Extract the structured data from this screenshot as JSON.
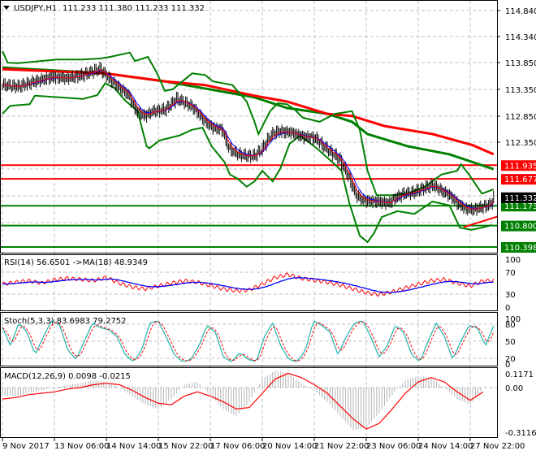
{
  "header": {
    "symbol": "USDJPY,H1",
    "ohlc": "111.233 111.380 111.233 111.332"
  },
  "colors": {
    "bull_bear_bars": "#000000",
    "bollinger": "#008000",
    "ma_slow_green": "#008000",
    "ma_slow_red": "#ff0000",
    "fast_ma_red": "#ff0000",
    "fast_ma_blue": "#0000ff",
    "level_red": "#ff0000",
    "level_green": "#008000",
    "stoch_main": "#20b2aa",
    "stoch_signal": "#ff0000",
    "macd_hist": "#b4b4b4",
    "macd_signal": "#ff0000",
    "rsi": "#ff0000",
    "rsi_ma": "#0000ff",
    "grid": "#c0c0c0"
  },
  "chart_data": [
    {
      "type": "line",
      "title": "USDJPY,H1",
      "ylim": [
        110.398,
        114.84
      ],
      "y_ticks": [
        "114.840",
        "114.340",
        "113.850",
        "113.350",
        "112.850",
        "112.350"
      ],
      "x_ticks": [
        "9 Nov 2017",
        "13 Nov 06:00",
        "14 Nov 14:00",
        "15 Nov 22:00",
        "17 Nov 06:00",
        "20 Nov 14:00",
        "21 Nov 22:00",
        "23 Nov 06:00",
        "24 Nov 14:00",
        "27 Nov 22:00"
      ],
      "grid": true,
      "price_close": [
        [
          0,
          113.44
        ],
        [
          12,
          113.41
        ],
        [
          25,
          113.51
        ],
        [
          38,
          113.59
        ],
        [
          50,
          113.57
        ],
        [
          62,
          113.63
        ],
        [
          75,
          113.74
        ],
        [
          84,
          113.51
        ],
        [
          97,
          113.25
        ],
        [
          103,
          112.95
        ],
        [
          109,
          112.86
        ],
        [
          116,
          112.95
        ],
        [
          125,
          112.98
        ],
        [
          134,
          113.18
        ],
        [
          141,
          113.1
        ],
        [
          147,
          113.01
        ],
        [
          156,
          112.75
        ],
        [
          162,
          112.64
        ],
        [
          169,
          112.6
        ],
        [
          174,
          112.25
        ],
        [
          181,
          112.14
        ],
        [
          188,
          112.11
        ],
        [
          194,
          112.11
        ],
        [
          200,
          112.25
        ],
        [
          206,
          112.49
        ],
        [
          212,
          112.57
        ],
        [
          222,
          112.55
        ],
        [
          231,
          112.47
        ],
        [
          241,
          112.44
        ],
        [
          247,
          112.29
        ],
        [
          253,
          112.17
        ],
        [
          259,
          112.06
        ],
        [
          266,
          111.73
        ],
        [
          272,
          111.37
        ],
        [
          278,
          111.27
        ],
        [
          288,
          111.25
        ],
        [
          297,
          111.22
        ],
        [
          303,
          111.33
        ],
        [
          309,
          111.4
        ],
        [
          316,
          111.42
        ],
        [
          322,
          111.48
        ],
        [
          331,
          111.56
        ],
        [
          338,
          111.45
        ],
        [
          344,
          111.37
        ],
        [
          350,
          111.22
        ],
        [
          356,
          111.12
        ],
        [
          362,
          111.1
        ],
        [
          369,
          111.15
        ],
        [
          375,
          111.19
        ],
        [
          378,
          111.33
        ]
      ],
      "bollinger_upper": [
        [
          0,
          114.08
        ],
        [
          4,
          113.86
        ],
        [
          12,
          113.85
        ],
        [
          42,
          113.92
        ],
        [
          62,
          113.92
        ],
        [
          75,
          113.94
        ],
        [
          83,
          113.97
        ],
        [
          98,
          114.05
        ],
        [
          102,
          113.89
        ],
        [
          112,
          113.97
        ],
        [
          119,
          113.66
        ],
        [
          125,
          113.33
        ],
        [
          131,
          113.36
        ],
        [
          146,
          113.66
        ],
        [
          156,
          113.63
        ],
        [
          162,
          113.51
        ],
        [
          177,
          113.44
        ],
        [
          188,
          113.13
        ],
        [
          194,
          112.75
        ],
        [
          197,
          112.52
        ],
        [
          206,
          112.95
        ],
        [
          212,
          113.1
        ],
        [
          219,
          113.08
        ],
        [
          225,
          112.98
        ],
        [
          231,
          112.83
        ],
        [
          244,
          112.75
        ],
        [
          256,
          112.9
        ],
        [
          269,
          112.95
        ],
        [
          275,
          112.6
        ],
        [
          281,
          111.83
        ],
        [
          288,
          111.37
        ],
        [
          300,
          111.37
        ],
        [
          312,
          111.4
        ],
        [
          325,
          111.53
        ],
        [
          338,
          111.76
        ],
        [
          350,
          111.83
        ],
        [
          353,
          111.95
        ],
        [
          359,
          111.76
        ],
        [
          369,
          111.4
        ],
        [
          378,
          111.48
        ]
      ],
      "bollinger_lower": [
        [
          0,
          112.9
        ],
        [
          6,
          113.05
        ],
        [
          21,
          113.08
        ],
        [
          25,
          113.24
        ],
        [
          62,
          113.18
        ],
        [
          73,
          113.25
        ],
        [
          79,
          113.47
        ],
        [
          86,
          113.39
        ],
        [
          94,
          113.16
        ],
        [
          104,
          112.95
        ],
        [
          111,
          112.29
        ],
        [
          113,
          112.25
        ],
        [
          121,
          112.4
        ],
        [
          136,
          112.49
        ],
        [
          146,
          112.6
        ],
        [
          154,
          112.64
        ],
        [
          161,
          112.29
        ],
        [
          171,
          111.99
        ],
        [
          175,
          111.76
        ],
        [
          181,
          111.68
        ],
        [
          188,
          111.53
        ],
        [
          194,
          111.63
        ],
        [
          200,
          111.83
        ],
        [
          208,
          111.63
        ],
        [
          214,
          111.88
        ],
        [
          221,
          112.34
        ],
        [
          229,
          112.49
        ],
        [
          242,
          112.25
        ],
        [
          254,
          111.99
        ],
        [
          261,
          111.83
        ],
        [
          267,
          111.22
        ],
        [
          275,
          110.61
        ],
        [
          281,
          110.49
        ],
        [
          286,
          110.66
        ],
        [
          292,
          110.96
        ],
        [
          304,
          111.07
        ],
        [
          317,
          111.02
        ],
        [
          331,
          111.25
        ],
        [
          344,
          111.18
        ],
        [
          352,
          110.76
        ],
        [
          361,
          110.72
        ],
        [
          369,
          110.76
        ],
        [
          377,
          110.81
        ]
      ],
      "ma_green": [
        [
          0,
          113.77
        ],
        [
          79,
          113.66
        ],
        [
          125,
          113.51
        ],
        [
          194,
          113.21
        ],
        [
          219,
          113.01
        ],
        [
          250,
          112.9
        ],
        [
          269,
          112.75
        ],
        [
          281,
          112.52
        ],
        [
          312,
          112.29
        ],
        [
          344,
          112.14
        ],
        [
          378,
          111.86
        ]
      ],
      "ma_red": [
        [
          0,
          113.74
        ],
        [
          79,
          113.66
        ],
        [
          125,
          113.51
        ],
        [
          156,
          113.44
        ],
        [
          194,
          113.24
        ],
        [
          219,
          113.13
        ],
        [
          250,
          112.9
        ],
        [
          269,
          112.86
        ],
        [
          294,
          112.67
        ],
        [
          331,
          112.52
        ],
        [
          362,
          112.31
        ],
        [
          378,
          112.14
        ]
      ],
      "trendline": [
        [
          355,
          110.77
        ],
        [
          381,
          110.97
        ]
      ],
      "levels": [
        {
          "value": "111.935",
          "color": "#ff0000"
        },
        {
          "value": "111.677",
          "color": "#ff0000"
        },
        {
          "value": "111.173",
          "color": "#008000"
        },
        {
          "value": "110.800",
          "color": "#008000"
        },
        {
          "value": "110.398",
          "color": "#008000"
        }
      ],
      "current_price": "111.332"
    },
    {
      "type": "line",
      "label": "RSI(14) 56.6501  ->MA(18) 48.9349",
      "ylim": [
        0,
        100
      ],
      "y_ticks": [
        "100",
        "70",
        "30",
        "0"
      ],
      "rsi": [
        48,
        52,
        55,
        50,
        57,
        60,
        58,
        55,
        62,
        50,
        42,
        38,
        44,
        50,
        55,
        52,
        45,
        38,
        34,
        36,
        48,
        62,
        68,
        60,
        56,
        52,
        46,
        38,
        30,
        26,
        32,
        40,
        48,
        55,
        58,
        50,
        44,
        55
      ]
    },
    {
      "type": "line",
      "label": "Stoch(5,3,3) 83.6983 79.2752",
      "ylim": [
        0,
        100
      ],
      "y_ticks": [
        "100",
        "80",
        "50",
        "20",
        "0"
      ],
      "stoch_main": [
        80,
        40,
        90,
        70,
        20,
        60,
        95,
        85,
        30,
        10,
        50,
        90,
        80,
        75,
        60,
        20,
        5,
        30,
        90,
        95,
        60,
        20,
        5,
        10,
        40,
        85,
        70,
        15,
        5,
        25,
        10,
        5,
        60,
        90,
        40,
        10,
        5,
        30,
        95,
        85,
        70,
        20,
        60,
        90,
        95,
        60,
        15,
        40,
        85,
        70,
        20,
        5,
        50,
        90,
        60,
        10,
        50,
        85,
        80,
        40,
        84
      ]
    },
    {
      "type": "bar",
      "label": "MACD(12,26,9) 0.0098 -0.0215",
      "ylim": [
        -0.3116,
        0.1171
      ],
      "y_ticks": [
        "0.1171",
        "0.00",
        "-0.3116"
      ],
      "histogram": [
        -0.05,
        -0.06,
        -0.04,
        -0.02,
        0.0,
        0.02,
        0.03,
        0.05,
        0.04,
        0.0,
        -0.06,
        -0.12,
        -0.15,
        -0.08,
        0.02,
        0.04,
        -0.05,
        -0.15,
        -0.2,
        -0.1,
        0.06,
        0.12,
        0.1,
        0.03,
        -0.02,
        -0.1,
        -0.2,
        -0.3,
        -0.28,
        -0.18,
        -0.05,
        0.05,
        0.08,
        0.07,
        0.0,
        -0.08,
        -0.12,
        0.0
      ],
      "signal": [
        -0.08,
        -0.07,
        -0.05,
        -0.04,
        -0.03,
        -0.01,
        0.0,
        0.02,
        0.03,
        0.02,
        -0.02,
        -0.07,
        -0.11,
        -0.12,
        -0.06,
        -0.03,
        -0.06,
        -0.1,
        -0.15,
        -0.14,
        -0.04,
        0.06,
        0.1,
        0.07,
        0.02,
        -0.04,
        -0.13,
        -0.22,
        -0.29,
        -0.25,
        -0.15,
        -0.04,
        0.04,
        0.07,
        0.04,
        -0.03,
        -0.09,
        -0.03
      ]
    }
  ]
}
